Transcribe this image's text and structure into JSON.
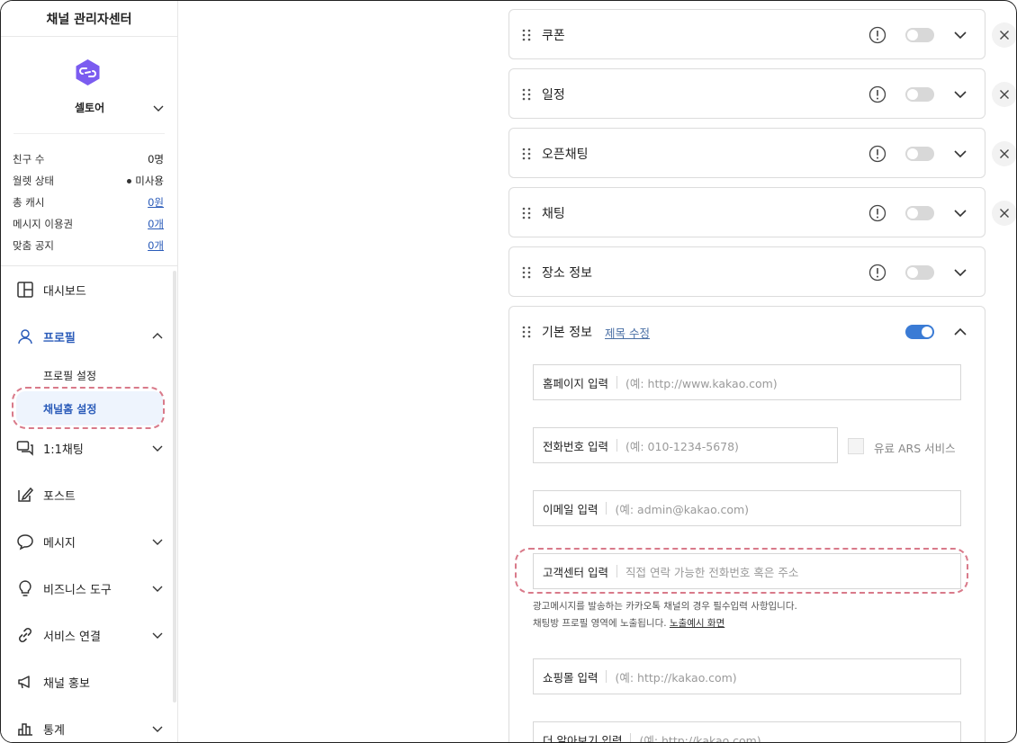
{
  "sidebar": {
    "title": "채널 관리자센터",
    "channel_name": "셀토어",
    "stats": [
      {
        "label": "친구 수",
        "value": "0명"
      },
      {
        "label": "월렛 상태",
        "value": "미사용"
      },
      {
        "label": "총 캐시",
        "value": "0원"
      },
      {
        "label": "메시지 이용권",
        "value": "0개"
      },
      {
        "label": "맞춤 공지",
        "value": "0개"
      }
    ],
    "nav": {
      "dashboard": "대시보드",
      "profile": "프로필",
      "profile_settings": "프로필 설정",
      "channel_home_settings": "채널홈 설정",
      "chat": "1:1채팅",
      "post": "포스트",
      "message": "메시지",
      "biz_tools": "비즈니스 도구",
      "service_link": "서비스 연결",
      "channel_promo": "채널 홍보",
      "stats": "통계"
    }
  },
  "cards": {
    "coupon": "쿠폰",
    "schedule": "일정",
    "openchat": "오픈채팅",
    "chat": "채팅",
    "place": "장소 정보",
    "basic": "기본 정보",
    "edit_title": "제목 수정"
  },
  "fields": {
    "homepage": {
      "label": "홈페이지 입력",
      "placeholder": "(예: http://www.kakao.com)"
    },
    "phone": {
      "label": "전화번호 입력",
      "placeholder": "(예: 010-1234-5678)"
    },
    "ars_label": "유료 ARS 서비스",
    "email": {
      "label": "이메일 입력",
      "placeholder": "(예: admin@kakao.com)"
    },
    "cs": {
      "label": "고객센터 입력",
      "placeholder": "직접 연락 가능한 전화번호 혹은 주소"
    },
    "help_line1": "광고메시지를 발송하는 카카오톡 채널의 경우 필수입력 사항입니다.",
    "help_line2": "채팅방 프로필 영역에 노출됩니다.",
    "help_link": "노출예시 화면",
    "shop": {
      "label": "쇼핑몰 입력",
      "placeholder": "(예: http://kakao.com)"
    },
    "more": {
      "label": "더 알아보기 입력",
      "placeholder": "(예: http://kakao.com)"
    }
  },
  "colors": {
    "accent": "#2a5bb9",
    "toggle_on": "#3a7bd5",
    "highlight": "#d97a8a"
  }
}
